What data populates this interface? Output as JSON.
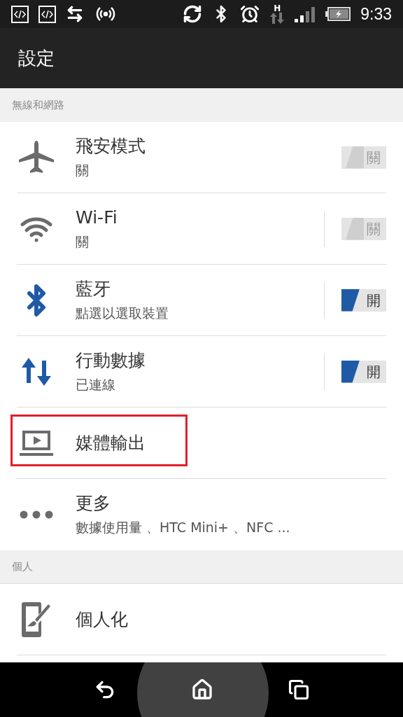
{
  "status_bar": {
    "network_type": "H",
    "time": "9:33"
  },
  "app_bar": {
    "title": "設定"
  },
  "sections": [
    {
      "header": "無線和網路",
      "items": [
        {
          "kind": "toggle",
          "title": "飛安模式",
          "subtitle": "關",
          "on": false,
          "switch_label": "關"
        },
        {
          "kind": "toggle",
          "title": "Wi-Fi",
          "subtitle": "關",
          "on": false,
          "switch_label": "關",
          "divider": true
        },
        {
          "kind": "toggle",
          "title": "藍牙",
          "subtitle": "點選以選取裝置",
          "on": true,
          "switch_label": "開",
          "divider": true
        },
        {
          "kind": "toggle",
          "title": "行動數據",
          "subtitle": "已連線",
          "on": true,
          "switch_label": "開",
          "divider": true
        },
        {
          "kind": "link",
          "title": "媒體輸出",
          "highlighted": true
        },
        {
          "kind": "link",
          "title": "更多",
          "subtitle": "數據使用量 、HTC Mini+ 、NFC ..."
        }
      ]
    },
    {
      "header": "個人",
      "items": [
        {
          "kind": "link",
          "title": "個人化"
        }
      ]
    }
  ]
}
